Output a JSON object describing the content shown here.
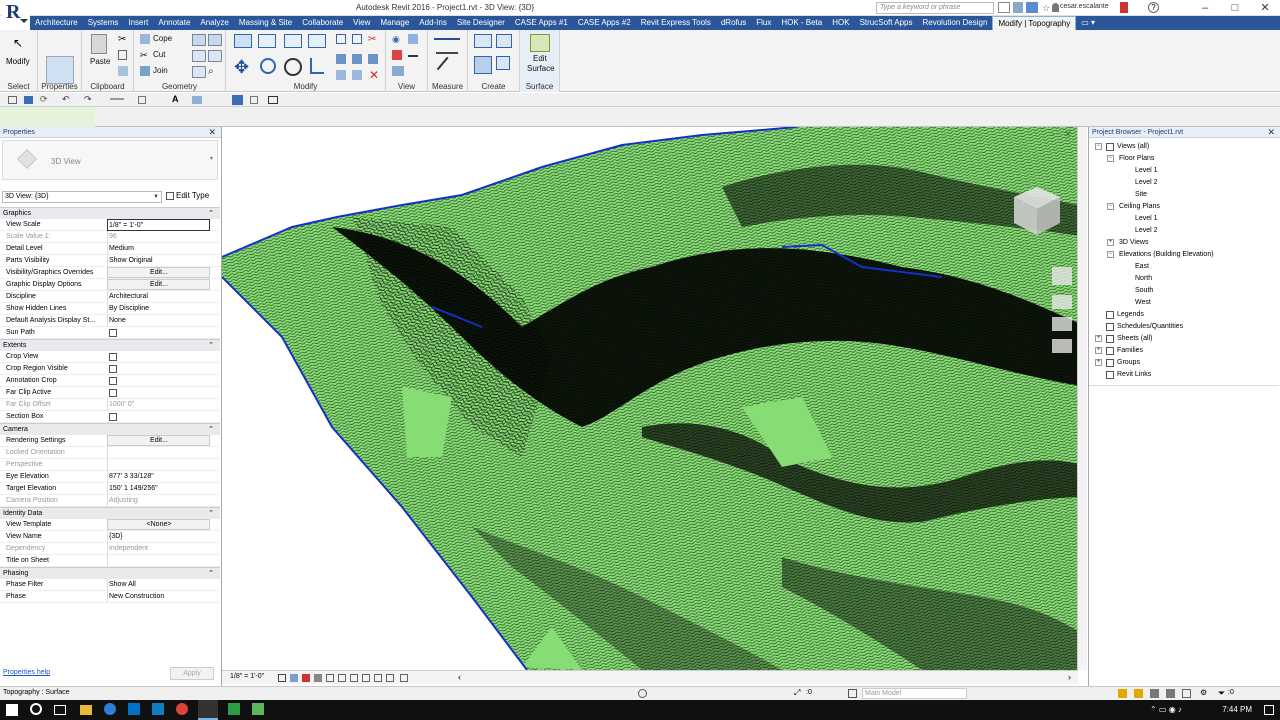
{
  "window": {
    "title": "Autodesk Revit 2016 -   Project1.rvt - 3D View: {3D}",
    "search_placeholder": "Type a keyword or phrase",
    "user": "cesar.escalante"
  },
  "tabs": [
    "Architecture",
    "Systems",
    "Insert",
    "Annotate",
    "Analyze",
    "Massing & Site",
    "Collaborate",
    "View",
    "Manage",
    "Add-Ins",
    "Site Designer",
    "CASE Apps #1",
    "CASE Apps #2",
    "Revit Express Tools",
    "dRofus",
    "Flux",
    "HOK - Beta",
    "HOK",
    "StrucSoft Apps",
    "Revolution Design",
    "Modify | Topography"
  ],
  "ribbon": {
    "panels": [
      "Select",
      "Properties",
      "Clipboard",
      "Geometry",
      "Modify",
      "View",
      "Measure",
      "Create",
      "Surface"
    ],
    "modify_label": "Modify",
    "paste_label": "Paste",
    "cope_label": "Cope",
    "cut_label": "Cut",
    "join_label": "Join",
    "edit_surface_label": "Edit\nSurface",
    "edit_label": "Edit",
    "surface_label": "Surface"
  },
  "properties": {
    "title": "Properties",
    "type_name": "3D View",
    "view_selector": "3D View: {3D}",
    "edit_type": "Edit Type",
    "sections": [
      {
        "name": "Graphics",
        "rows": [
          {
            "n": "View Scale",
            "v": "1/8\" = 1'-0\"",
            "kind": "sel"
          },
          {
            "n": "Scale Value    1:",
            "v": "96",
            "kind": "dim"
          },
          {
            "n": "Detail Level",
            "v": "Medium"
          },
          {
            "n": "Parts Visibility",
            "v": "Show Original"
          },
          {
            "n": "Visibility/Graphics Overrides",
            "v": "Edit...",
            "kind": "btn"
          },
          {
            "n": "Graphic Display Options",
            "v": "Edit...",
            "kind": "btn"
          },
          {
            "n": "Discipline",
            "v": "Architectural"
          },
          {
            "n": "Show Hidden Lines",
            "v": "By Discipline"
          },
          {
            "n": "Default Analysis Display St...",
            "v": "None"
          },
          {
            "n": "Sun Path",
            "v": "",
            "kind": "cb"
          }
        ]
      },
      {
        "name": "Extents",
        "rows": [
          {
            "n": "Crop View",
            "v": "",
            "kind": "cb"
          },
          {
            "n": "Crop Region Visible",
            "v": "",
            "kind": "cb"
          },
          {
            "n": "Annotation Crop",
            "v": "",
            "kind": "cb"
          },
          {
            "n": "Far Clip Active",
            "v": "",
            "kind": "cb"
          },
          {
            "n": "Far Clip Offset",
            "v": "1000'  0\"",
            "kind": "dim"
          },
          {
            "n": "Section Box",
            "v": "",
            "kind": "cb"
          }
        ]
      },
      {
        "name": "Camera",
        "rows": [
          {
            "n": "Rendering Settings",
            "v": "Edit...",
            "kind": "btn"
          },
          {
            "n": "Locked Orientation",
            "v": "",
            "kind": "dim"
          },
          {
            "n": "Perspective",
            "v": "",
            "kind": "dim"
          },
          {
            "n": "Eye Elevation",
            "v": "877'  3 33/128\""
          },
          {
            "n": "Target Elevation",
            "v": "150'  1 149/256\""
          },
          {
            "n": "Camera Position",
            "v": "Adjusting",
            "kind": "dim"
          }
        ]
      },
      {
        "name": "Identity Data",
        "rows": [
          {
            "n": "View Template",
            "v": "<None>",
            "kind": "btn"
          },
          {
            "n": "View Name",
            "v": "{3D}"
          },
          {
            "n": "Dependency",
            "v": "Independent",
            "kind": "dim"
          },
          {
            "n": "Title on Sheet",
            "v": ""
          }
        ]
      },
      {
        "name": "Phasing",
        "rows": [
          {
            "n": "Phase Filter",
            "v": "Show All"
          },
          {
            "n": "Phase",
            "v": "New Construction"
          }
        ]
      }
    ],
    "help": "Properties help",
    "apply": "Apply"
  },
  "browser": {
    "title": "Project Browser - Project1.rvt",
    "nodes": [
      {
        "label": "Views (all)",
        "level": 0,
        "toggle": "−"
      },
      {
        "label": "Floor Plans",
        "level": 1,
        "toggle": "−"
      },
      {
        "label": "Level 1",
        "level": 2
      },
      {
        "label": "Level 2",
        "level": 2
      },
      {
        "label": "Site",
        "level": 2
      },
      {
        "label": "Ceiling Plans",
        "level": 1,
        "toggle": "−"
      },
      {
        "label": "Level 1",
        "level": 2
      },
      {
        "label": "Level 2",
        "level": 2
      },
      {
        "label": "3D Views",
        "level": 1,
        "toggle": "+"
      },
      {
        "label": "Elevations (Building Elevation)",
        "level": 1,
        "toggle": "−"
      },
      {
        "label": "East",
        "level": 2
      },
      {
        "label": "North",
        "level": 2
      },
      {
        "label": "South",
        "level": 2
      },
      {
        "label": "West",
        "level": 2
      },
      {
        "label": "Legends",
        "level": 0,
        "icon": true
      },
      {
        "label": "Schedules/Quantities",
        "level": 0,
        "icon": true
      },
      {
        "label": "Sheets (all)",
        "level": 0,
        "icon": true,
        "toggle": "+"
      },
      {
        "label": "Families",
        "level": 0,
        "toggle": "+"
      },
      {
        "label": "Groups",
        "level": 0,
        "toggle": "+"
      },
      {
        "label": "Revit Links",
        "level": 0,
        "icon": true
      }
    ]
  },
  "viewbar": {
    "scale": "1/8\" = 1'-0\""
  },
  "status": {
    "text": "Topography : Surface",
    "workset": ":0",
    "model": "Main Model",
    "filter": ":0"
  },
  "taskbar": {
    "time": "7:44 PM"
  },
  "colors": {
    "terrain": "#86dd74",
    "ribbon_tab": "#2b579a",
    "boundary": "#1530c8"
  }
}
